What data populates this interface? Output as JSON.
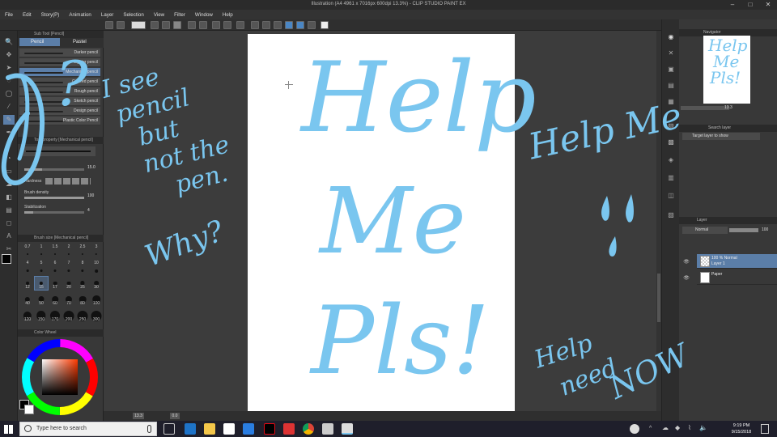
{
  "titlebar": {
    "title": "Illustration (A4 4961 x 7016px 600dpi 13.3%) - CLIP STUDIO PAINT EX"
  },
  "menu": {
    "items": [
      "File",
      "Edit",
      "Story(P)",
      "Animation",
      "Layer",
      "Selection",
      "View",
      "Filter",
      "Window",
      "Help"
    ]
  },
  "subtool": {
    "header": "Sub Tool [Pencil]",
    "tabs": [
      {
        "label": "Pencil"
      },
      {
        "label": "Pastel"
      }
    ],
    "pencils": [
      "Darker pencil",
      "Lighter pencil",
      "Mechanical pencil",
      "Colored pencil",
      "Rough pencil",
      "Sketch pencil",
      "Design pencil",
      "Plastic Color Pencil"
    ]
  },
  "toolprop": {
    "header": "Tool property [Mechanical pencil]",
    "brush_size_value": "15.0",
    "hardness_label": "Hardness",
    "density_label": "Brush density",
    "density_value": "100",
    "stabilization_label": "Stabilization",
    "stabilization_value": "4"
  },
  "brushsize": {
    "header": "Brush size [Mechanical pencil]",
    "sizes": [
      "0.7",
      "1",
      "1.5",
      "2",
      "2.5",
      "3",
      "4",
      "5",
      "6",
      "7",
      "8",
      "10",
      "12",
      "15",
      "17",
      "20",
      "25",
      "30",
      "40",
      "50",
      "60",
      "70",
      "80",
      "100",
      "120",
      "150",
      "170",
      "200",
      "250",
      "300"
    ],
    "selected": "15"
  },
  "color": {
    "header": "Color Wheel"
  },
  "navigator": {
    "header": "Navigator",
    "zoom": "13.3"
  },
  "search_layer": {
    "header": "Search layer",
    "option": "Target layer to show"
  },
  "layer": {
    "header": "Layer",
    "blend_mode": "Normal",
    "opacity": "100",
    "rows": [
      {
        "line1": "100 % Normal",
        "line2": "Layer 1",
        "selected": true
      },
      {
        "line1": "",
        "line2": "Paper",
        "selected": false
      }
    ]
  },
  "statusbar": {
    "zoom": "13.3",
    "rotation": "0.0"
  },
  "taskbar": {
    "search_placeholder": "Type here to search",
    "time": "9:19 PM",
    "date": "9/15/2018"
  },
  "annotations": {
    "canvas_lines": [
      "Help",
      "Me",
      "Pls!"
    ],
    "question": "I see pencil but not the pen. Why?",
    "question_lines": [
      "I see",
      "pencil",
      "but",
      "not the",
      "pen.",
      "Why?"
    ],
    "help_me": "Help Me",
    "help_need_now": [
      "Help",
      "need",
      "NOW"
    ],
    "navigator_text": [
      "Help",
      "Me",
      "Pls!"
    ],
    "question_mark": "?"
  },
  "colors": {
    "annotation": "#7ac6ef",
    "selected": "#5b7ea8"
  }
}
